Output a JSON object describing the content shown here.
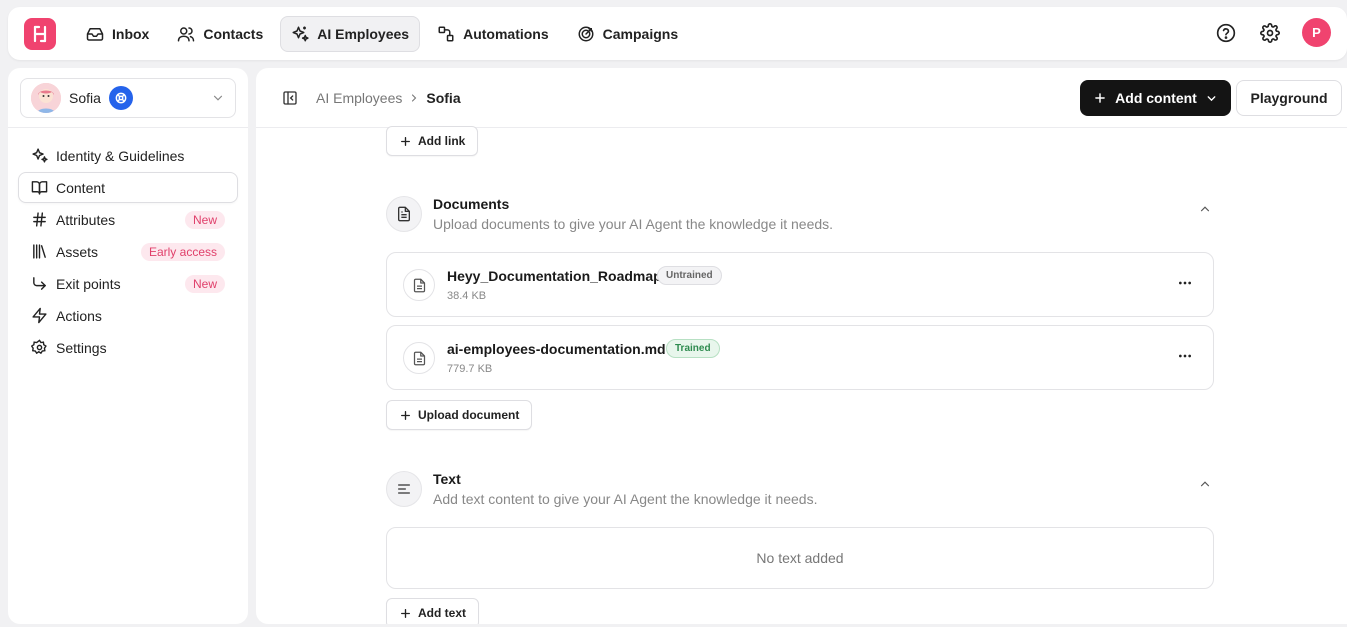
{
  "colors": {
    "brand": "#f0436f",
    "primary_button": "#141414",
    "badge_blue": "#2563eb"
  },
  "topbar": {
    "logo_icon": "brand-logo-icon",
    "nav": [
      {
        "label": "Inbox",
        "icon": "inbox-icon",
        "active": false
      },
      {
        "label": "Contacts",
        "icon": "contacts-icon",
        "active": false
      },
      {
        "label": "AI Employees",
        "icon": "sparkles-icon",
        "active": true
      },
      {
        "label": "Automations",
        "icon": "automations-icon",
        "active": false
      },
      {
        "label": "Campaigns",
        "icon": "campaigns-icon",
        "active": false
      }
    ],
    "avatar_initial": "P"
  },
  "sidebar": {
    "agent": {
      "name": "Sofia"
    },
    "items": [
      {
        "label": "Identity & Guidelines",
        "icon": "sparkles-icon",
        "badge": ""
      },
      {
        "label": "Content",
        "icon": "book-icon",
        "badge": "",
        "active": true
      },
      {
        "label": "Attributes",
        "icon": "hash-icon",
        "badge": "New"
      },
      {
        "label": "Assets",
        "icon": "library-icon",
        "badge": "Early access"
      },
      {
        "label": "Exit points",
        "icon": "corner-down-right-icon",
        "badge": "New"
      },
      {
        "label": "Actions",
        "icon": "zap-icon",
        "badge": ""
      },
      {
        "label": "Settings",
        "icon": "gear-icon",
        "badge": ""
      }
    ]
  },
  "header": {
    "breadcrumb_parent": "AI Employees",
    "breadcrumb_current": "Sofia",
    "add_content_label": "Add content",
    "playground_label": "Playground"
  },
  "links": {
    "add_link_label": "Add link"
  },
  "documents": {
    "title": "Documents",
    "description": "Upload documents to give your AI Agent the knowledge it needs.",
    "items": [
      {
        "name": "Heyy_Documentation_Roadmap",
        "size": "38.4 KB",
        "status": "Untrained"
      },
      {
        "name": "ai-employees-documentation.md",
        "size": "779.7 KB",
        "status": "Trained"
      }
    ],
    "upload_label": "Upload document"
  },
  "text": {
    "title": "Text",
    "description": "Add text content to give your AI Agent the knowledge it needs.",
    "empty_label": "No text added",
    "add_label": "Add text"
  }
}
